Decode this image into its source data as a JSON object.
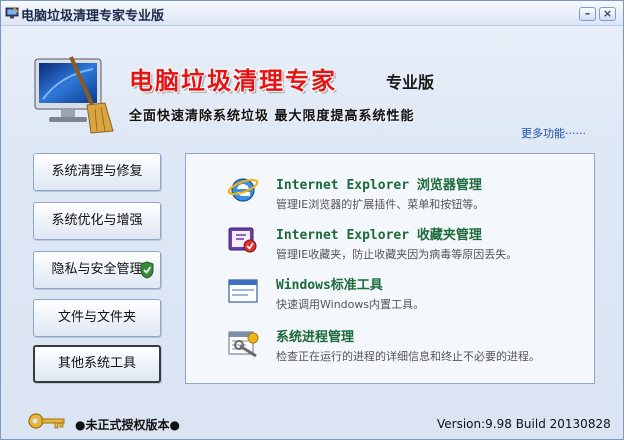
{
  "window": {
    "title": "电脑垃圾清理专家专业版",
    "minimize_label": "–",
    "close_label": "×"
  },
  "banner": {
    "title": "电脑垃圾清理专家",
    "edition": "专业版",
    "slogan": "全面快速清除系统垃圾  最大限度提高系统性能"
  },
  "more_link": "更多功能······",
  "nav": {
    "items": [
      {
        "label": "系统清理与修复"
      },
      {
        "label": "系统优化与增强"
      },
      {
        "label": "隐私与安全管理"
      },
      {
        "label": "文件与文件夹"
      },
      {
        "label": "其他系统工具"
      }
    ]
  },
  "tools": [
    {
      "title_en": "Internet Explorer ",
      "title_zh": "浏览器管理",
      "desc": "管理IE浏览器的扩展插件、菜单和按钮等。",
      "icon": "ie-icon"
    },
    {
      "title_en": "Internet Explorer ",
      "title_zh": "收藏夹管理",
      "desc": "管理IE收藏夹，防止收藏夹因为病毒等原因丢失。",
      "icon": "favorites-icon"
    },
    {
      "title_en": "Windows",
      "title_zh": "标准工具",
      "desc": "快速调用Windows内置工具。",
      "icon": "window-icon"
    },
    {
      "title_en": "",
      "title_zh": "系统进程管理",
      "desc": "检查正在运行的进程的详细信息和终止不必要的进程。",
      "icon": "process-icon"
    }
  ],
  "footer": {
    "license": "●未正式授权版本●",
    "version": "Version:9.98 Build 20130828"
  }
}
